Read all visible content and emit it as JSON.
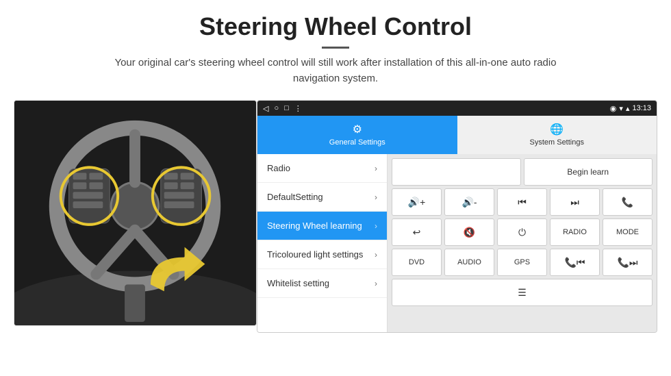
{
  "header": {
    "title": "Steering Wheel Control",
    "subtitle": "Your original car's steering wheel control will still work after installation of this all-in-one auto radio navigation system."
  },
  "status_bar": {
    "back": "◁",
    "home": "○",
    "square": "□",
    "menu": "⋮",
    "wifi": "▾",
    "signal": "▴",
    "time": "13:13"
  },
  "tabs": [
    {
      "id": "general",
      "label": "General Settings",
      "active": true
    },
    {
      "id": "system",
      "label": "System Settings",
      "active": false
    }
  ],
  "menu": [
    {
      "id": "radio",
      "label": "Radio",
      "active": false
    },
    {
      "id": "default",
      "label": "DefaultSetting",
      "active": false
    },
    {
      "id": "steering",
      "label": "Steering Wheel learning",
      "active": true
    },
    {
      "id": "tricolour",
      "label": "Tricoloured light settings",
      "active": false
    },
    {
      "id": "whitelist",
      "label": "Whitelist setting",
      "active": false
    }
  ],
  "buttons": {
    "begin_learn": "Begin learn",
    "row1": [
      "🔊+",
      "🔊-",
      "⏮",
      "⏭",
      "📞"
    ],
    "row2": [
      "↩",
      "🔊x",
      "⏻",
      "RADIO",
      "MODE"
    ],
    "row3": [
      "DVD",
      "AUDIO",
      "GPS",
      "📞⏮",
      "📞⏭"
    ],
    "row4_icon": "≡"
  }
}
